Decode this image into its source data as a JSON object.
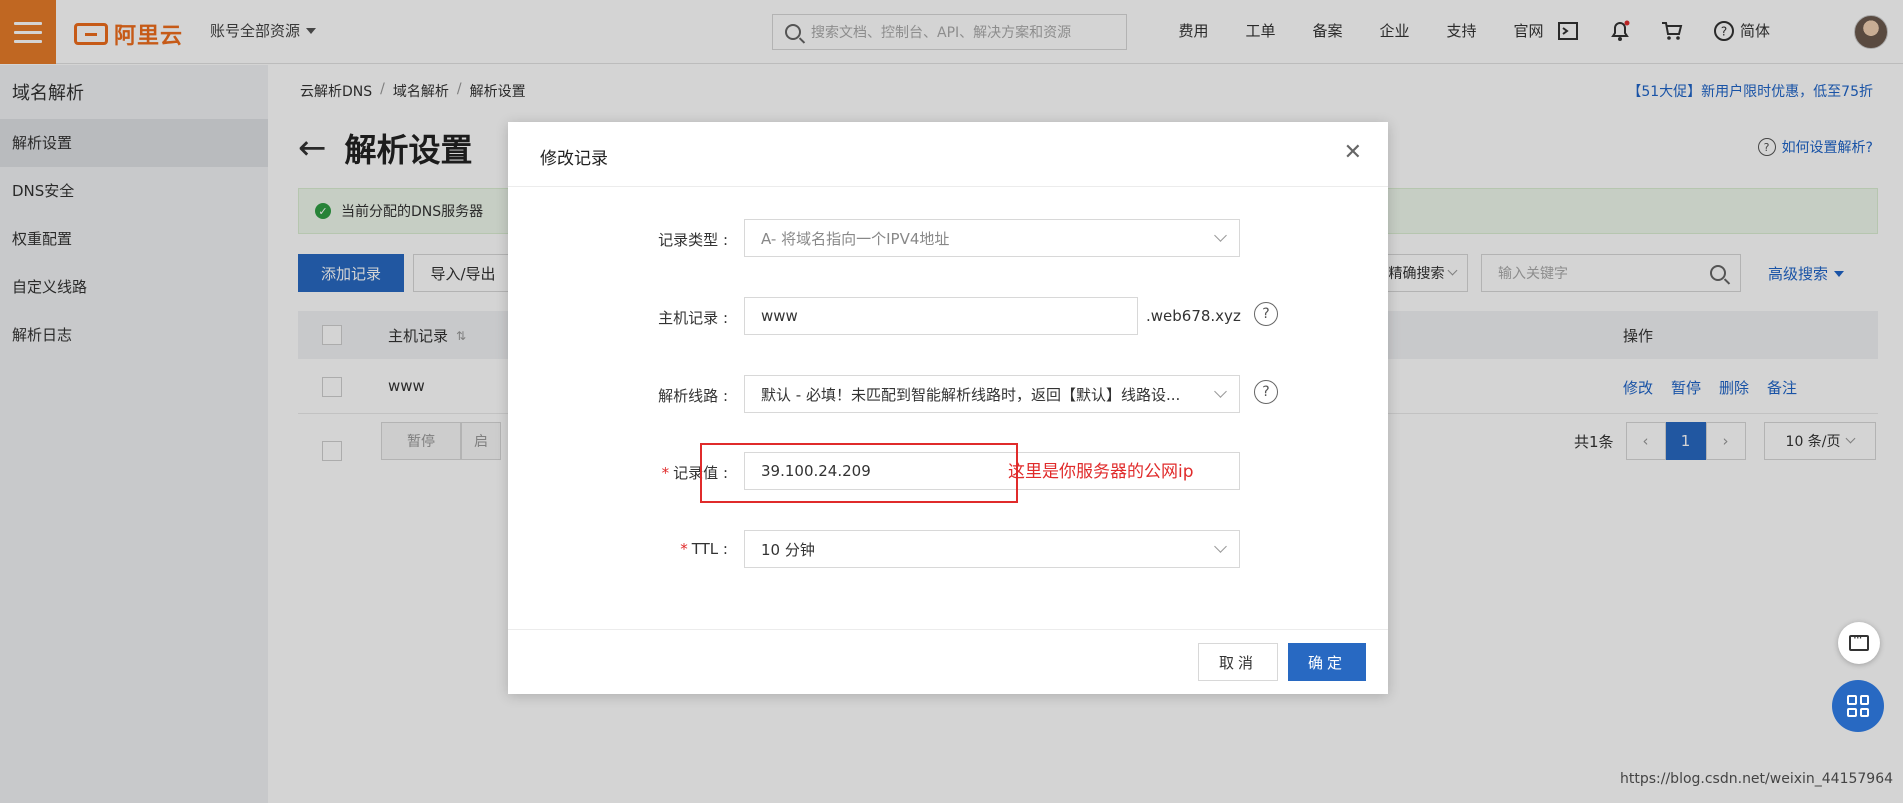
{
  "topbar": {
    "logo_text": "阿里云",
    "account_label": "账号全部资源",
    "search_placeholder": "搜索文档、控制台、API、解决方案和资源",
    "nav": [
      "费用",
      "工单",
      "备案",
      "企业",
      "支持",
      "官网"
    ],
    "icons": [
      "terminal-icon",
      "bell-icon",
      "cart-icon",
      "help-icon"
    ],
    "lang": "简体"
  },
  "sidebar": {
    "title": "域名解析",
    "items": [
      {
        "label": "解析设置",
        "active": true
      },
      {
        "label": "DNS安全",
        "active": false
      },
      {
        "label": "权重配置",
        "active": false
      },
      {
        "label": "自定义线路",
        "active": false
      },
      {
        "label": "解析日志",
        "active": false
      }
    ]
  },
  "main": {
    "breadcrumb": [
      "云解析DNS",
      "域名解析",
      "解析设置"
    ],
    "promo": "【51大促】新用户限时优惠，低至75折",
    "title": "解析设置",
    "help_link": "如何设置解析?",
    "notice": "当前分配的DNS服务器",
    "add_button": "添加记录",
    "import_button": "导入/导出",
    "exact_search": "精确搜索",
    "keyword_placeholder": "输入关键字",
    "adv_search": "高级搜索",
    "table": {
      "col_host": "主机记录",
      "col_op": "操作",
      "rows": [
        {
          "host": "www",
          "actions": [
            "修改",
            "暂停",
            "删除",
            "备注"
          ]
        }
      ]
    },
    "footer_buttons": [
      "暂停",
      "启"
    ],
    "pager": {
      "total": "共1条",
      "current": "1",
      "page_size": "10 条/页"
    }
  },
  "modal": {
    "title": "修改记录",
    "fields": {
      "type": {
        "label": "记录类型 :",
        "value": "A- 将域名指向一个IPV4地址"
      },
      "host": {
        "label": "主机记录 :",
        "value": "www",
        "suffix": ".web678.xyz"
      },
      "line": {
        "label": "解析线路 :",
        "value": "默认 - 必填！未匹配到智能解析线路时，返回【默认】线路设..."
      },
      "value": {
        "label": "记录值 :",
        "value": "39.100.24.209",
        "required": true
      },
      "ttl": {
        "label": "TTL :",
        "value": "10 分钟",
        "required": true
      }
    },
    "annotation": "这里是你服务器的公网ip",
    "cancel": "取消",
    "confirm": "确定"
  },
  "watermark": "https://blog.csdn.net/weixin_44157964"
}
